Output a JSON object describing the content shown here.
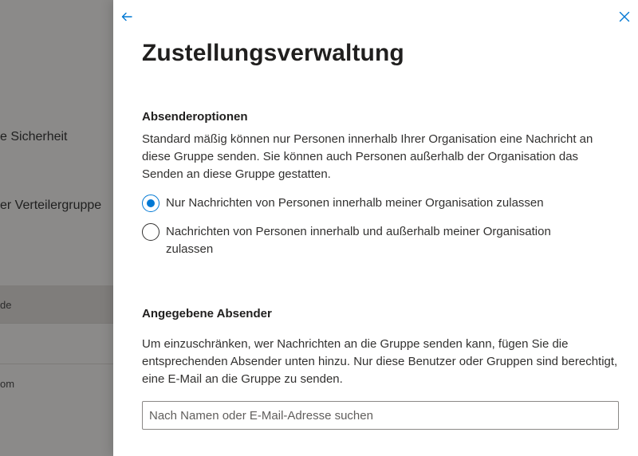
{
  "background": {
    "items": [
      "e Sicherheit",
      "er Verteilergruppe"
    ],
    "rows": [
      "de",
      "om"
    ]
  },
  "panel": {
    "title": "Zustellungsverwaltung",
    "sender_options": {
      "heading": "Absenderoptionen",
      "description": "Standard mäßig können nur Personen innerhalb Ihrer Organisation eine Nachricht an diese Gruppe senden. Sie können auch Personen außerhalb der Organisation das Senden an diese Gruppe gestatten.",
      "options": [
        {
          "label": "Nur Nachrichten von Personen innerhalb meiner Organisation zulassen",
          "selected": true
        },
        {
          "label": "Nachrichten von Personen innerhalb und außerhalb meiner Organisation zulassen",
          "selected": false
        }
      ]
    },
    "specified_senders": {
      "heading": "Angegebene Absender",
      "description": "Um einzuschränken, wer Nachrichten an die Gruppe senden kann, fügen Sie die entsprechenden Absender unten hinzu. Nur diese Benutzer oder Gruppen sind berechtigt, eine E-Mail an die Gruppe zu senden.",
      "search_placeholder": "Nach Namen oder E-Mail-Adresse suchen",
      "search_value": ""
    }
  },
  "colors": {
    "accent": "#0078d4",
    "text": "#323130",
    "overlay": "#8a8886"
  },
  "icons": {
    "back": "arrow-left-icon",
    "close": "close-icon"
  }
}
